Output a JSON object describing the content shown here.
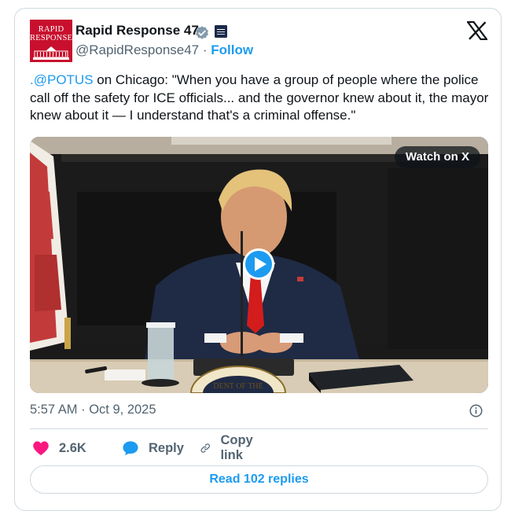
{
  "author": {
    "avatar_line1": "RAPID",
    "avatar_line2": "RESPONSE",
    "display_name": "Rapid Response 47",
    "handle": "@RapidResponse47",
    "separator": "·",
    "follow_label": "Follow",
    "verified_icon": "verified-badge-icon",
    "affiliation_icon": "government-flag-icon"
  },
  "tweet": {
    "mention": ".@POTUS",
    "text": " on Chicago: \"When you have a group of people where the police call off the safety for ICE officials... and the governor knew about it, the mayor knew about it — I understand that's a criminal offense.\"",
    "media": {
      "watch_label": "Watch on X",
      "play_icon": "play-icon",
      "seal_text": "DENT OF THE"
    },
    "time": "5:57 AM",
    "date_separator": " · ",
    "date": "Oct 9, 2025"
  },
  "actions": {
    "like_count": "2.6K",
    "reply_label": "Reply",
    "copy_label": "Copy link"
  },
  "read_replies_label": "Read 102 replies",
  "colors": {
    "accent": "#1d9bf0",
    "like": "#f91880",
    "muted": "#536471",
    "brand_red": "#c8102e"
  }
}
